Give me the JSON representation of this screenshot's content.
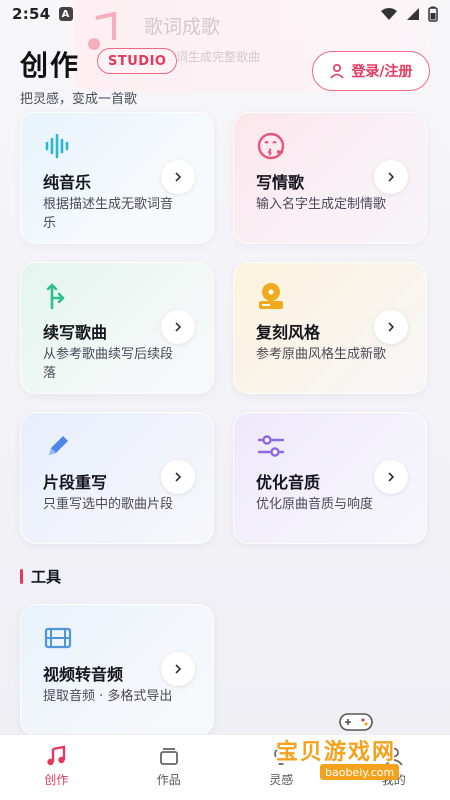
{
  "status_bar": {
    "time": "2:54",
    "indicator": "A"
  },
  "banner": {
    "title": "歌词成歌",
    "subtitle": "歌词生成完整歌曲"
  },
  "header": {
    "title": "创作",
    "badge": "STUDIO",
    "subtitle": "把灵感，变成一首歌",
    "login_label": "登录/注册"
  },
  "features": [
    {
      "title": "纯音乐",
      "desc": "根据描述生成无歌词音乐",
      "icon": "waveform-icon",
      "accent": "#2bb5d8"
    },
    {
      "title": "写情歌",
      "desc": "输入名字生成定制情歌",
      "icon": "kiss-face-icon",
      "accent": "#e9557a"
    },
    {
      "title": "续写歌曲",
      "desc": "从参考歌曲续写后续段落",
      "icon": "branch-arrow-icon",
      "accent": "#2fbf8f"
    },
    {
      "title": "复刻风格",
      "desc": "参考原曲风格生成新歌",
      "icon": "disc-player-icon",
      "accent": "#f1a91d"
    },
    {
      "title": "片段重写",
      "desc": "只重写选中的歌曲片段",
      "icon": "pencil-icon",
      "accent": "#4f86e8"
    },
    {
      "title": "优化音质",
      "desc": "优化原曲音质与响度",
      "icon": "sliders-icon",
      "accent": "#8d6ae3"
    }
  ],
  "tools_section": {
    "title": "工具",
    "items": [
      {
        "title": "视频转音频",
        "desc": "提取音频 · 多格式导出",
        "icon": "film-icon",
        "accent": "#4f95d9"
      }
    ]
  },
  "bottom_nav": [
    {
      "label": "创作",
      "icon": "music-note-icon",
      "active": true
    },
    {
      "label": "作品",
      "icon": "stack-icon",
      "active": false
    },
    {
      "label": "灵感",
      "icon": "bulb-icon",
      "active": false
    },
    {
      "label": "我的",
      "icon": "user-icon",
      "active": false
    }
  ],
  "watermark": {
    "text": "宝贝游戏网",
    "url": "baobeiy.com"
  },
  "colors": {
    "brand": "#e5385d",
    "text": "#15151d"
  }
}
